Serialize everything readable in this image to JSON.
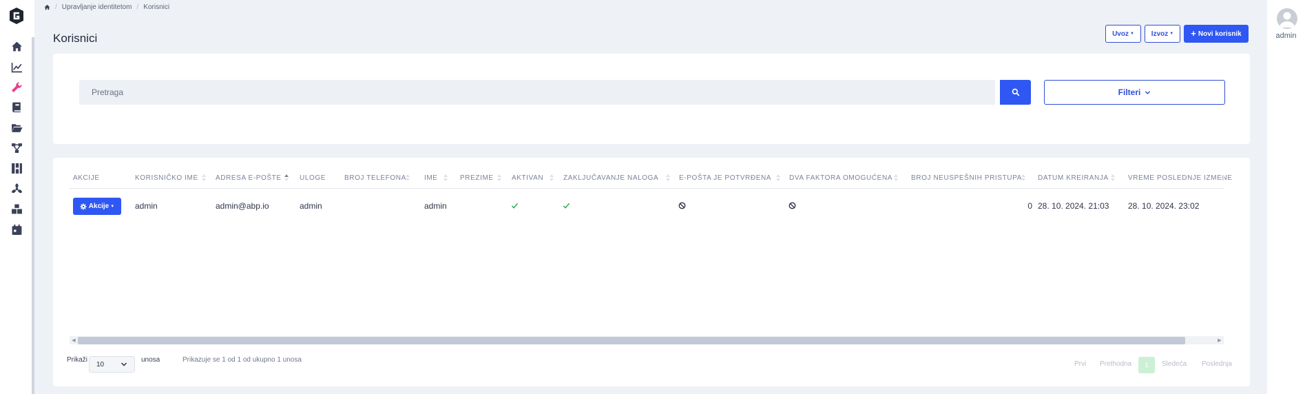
{
  "app": {
    "logo": "G",
    "nav_icons": [
      "home-icon",
      "chart-line-icon",
      "wrench-icon",
      "book-icon",
      "folder-open-icon",
      "network-icon",
      "grid-icon",
      "fan-icon",
      "boxes-icon",
      "calendar-icon"
    ]
  },
  "breadcrumb": {
    "items": [
      "Upravljanje identitetom",
      "Korisnici"
    ]
  },
  "page": {
    "title": "Korisnici",
    "import_label": "Uvoz",
    "export_label": "Izvoz",
    "new_user_label": "Novi korisnik"
  },
  "search": {
    "placeholder": "Pretraga",
    "filters_label": "Filteri"
  },
  "table": {
    "columns": [
      "Akcije",
      "Korisničko ime",
      "Adresa e-pošte",
      "Uloge",
      "Broj telefona",
      "Ime",
      "Prezime",
      "Aktivan",
      "Zaključavanje naloga",
      "E-pošta je potvrđena",
      "Dva faktora omogućena",
      "Broj neuspešnih pristupa",
      "Datum kreiranja",
      "Vreme poslednje izmene"
    ],
    "rows": [
      {
        "actions_label": "Akcije",
        "username": "admin",
        "email": "admin@abp.io",
        "roles": "admin",
        "phone": "",
        "name": "admin",
        "surname": "",
        "active": true,
        "lockout": true,
        "email_confirmed": false,
        "two_factor": false,
        "failed_attempts": "0",
        "created": "28. 10. 2024. 21:03",
        "modified": "28. 10. 2024. 23:02"
      }
    ]
  },
  "footer": {
    "show_label": "Prikaži",
    "page_size": "10",
    "entries_label": "unosa",
    "info": "Prikazuje se 1 od 1 od ukupno 1 unosa"
  },
  "pagination": {
    "first": "Prvi",
    "previous": "Prethodna",
    "current": "1",
    "next": "Sledeća",
    "last": "Poslednja"
  },
  "user": {
    "name": "admin"
  },
  "colors": {
    "primary": "#2f57f3",
    "active_nav": "#e83e8c",
    "check": "#28a745"
  }
}
